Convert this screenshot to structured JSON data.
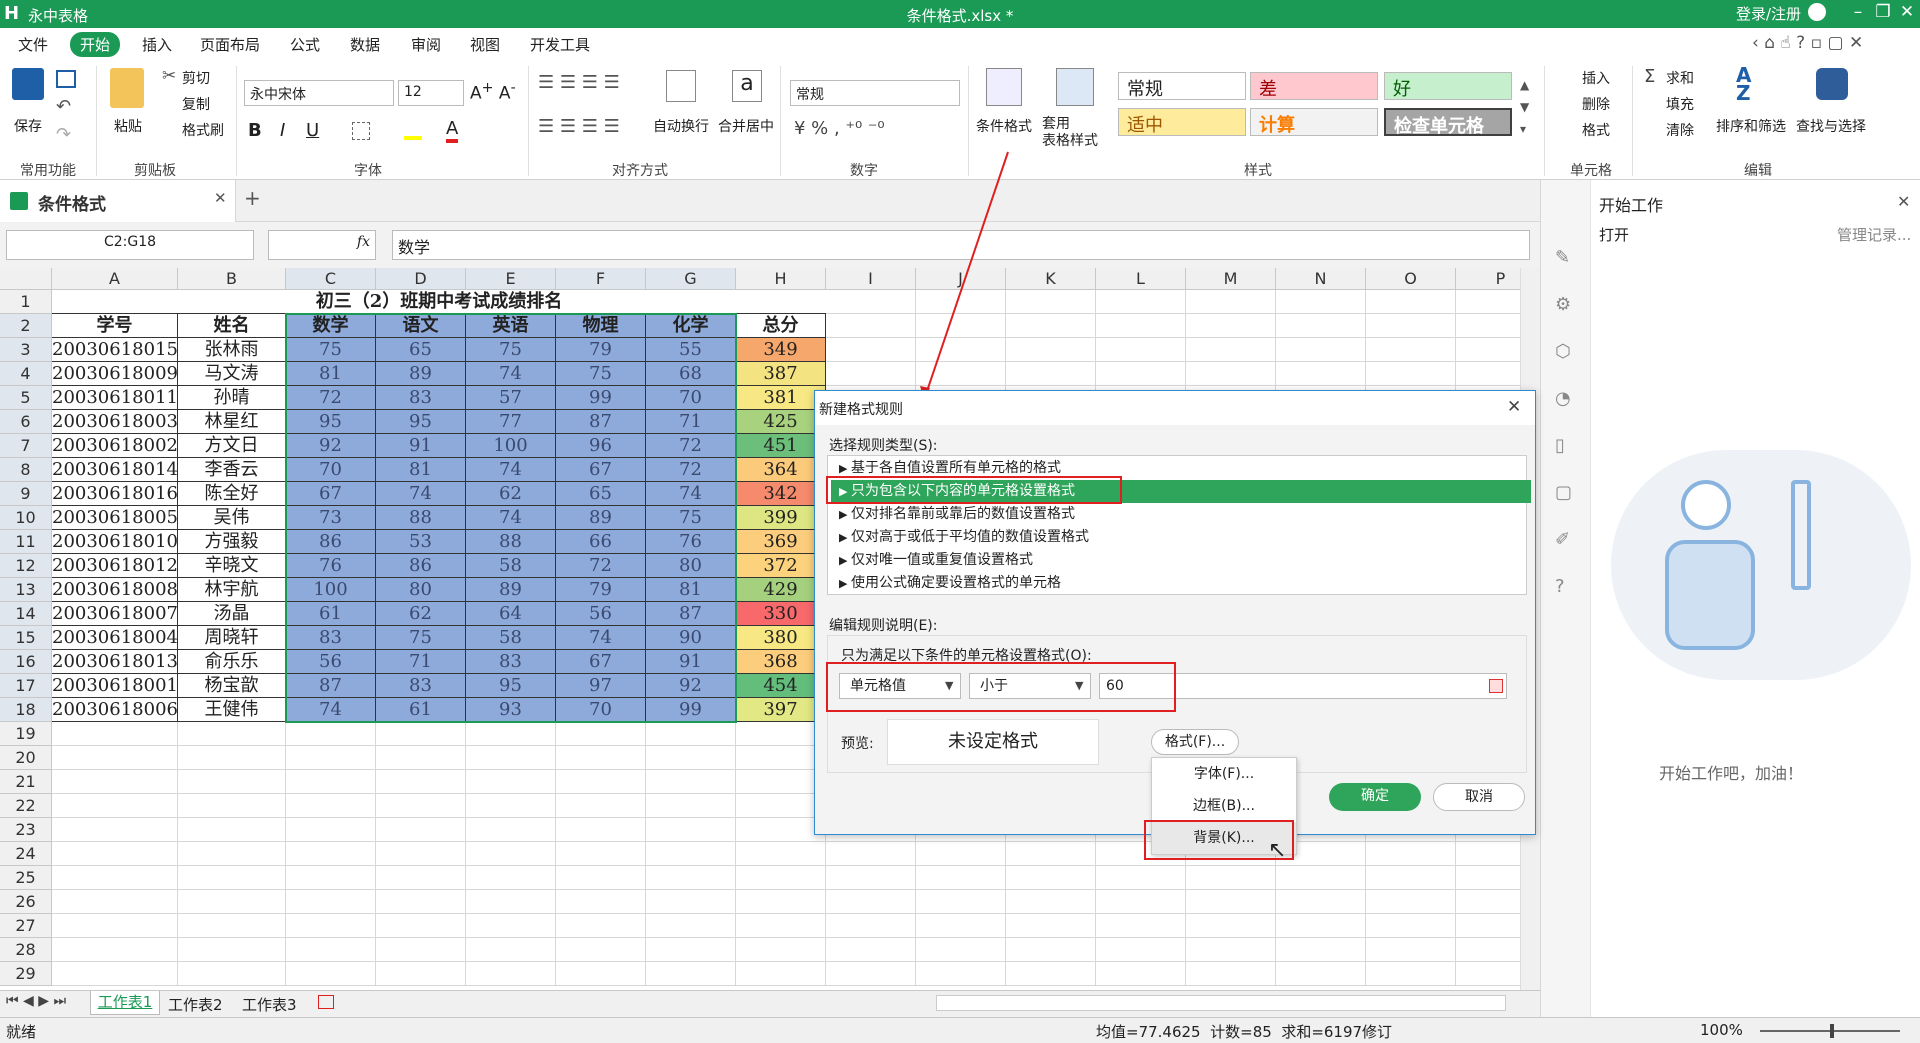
{
  "app": {
    "name": "永中表格",
    "logo": "H",
    "doc_title": "条件格式.xlsx *",
    "login": "登录/注册"
  },
  "menu": [
    "文件",
    "开始",
    "插入",
    "页面布局",
    "公式",
    "数据",
    "审阅",
    "视图",
    "开发工具"
  ],
  "menu_active": "开始",
  "ribbon": {
    "save": "保存",
    "paste": "粘贴",
    "cut": "剪切",
    "copy": "复制",
    "format_painter": "格式刷",
    "font_name": "永中宋体",
    "font_size": "12",
    "wrap": "自动换行",
    "merge": "合并居中",
    "number_format": "常规",
    "cond_format": "条件格式",
    "table_format": "套用\n表格样式",
    "styles": {
      "normal": "常规",
      "bad": "差",
      "good": "好",
      "neutral": "适中",
      "calc": "计算",
      "check": "检查单元格"
    },
    "insert": "插入",
    "delete": "删除",
    "format": "格式",
    "sum": "求和",
    "fill": "填充",
    "clear": "清除",
    "sort": "排序和筛选",
    "find": "查找与选择",
    "groups": {
      "common": "常用功能",
      "clipboard": "剪贴板",
      "font": "字体",
      "align": "对齐方式",
      "number": "数字",
      "style": "样式",
      "cells": "单元格",
      "edit": "编辑"
    }
  },
  "doc_tab": "条件格式",
  "formula_bar": {
    "name_box": "C2:G18",
    "fx": "fx",
    "content": "数学"
  },
  "grid": {
    "columns": [
      "A",
      "B",
      "C",
      "D",
      "E",
      "F",
      "G",
      "H",
      "I",
      "J",
      "K",
      "L",
      "M",
      "N",
      "O",
      "P"
    ],
    "rows": [
      "1",
      "2",
      "3",
      "4",
      "5",
      "6",
      "7",
      "8",
      "9",
      "10",
      "11",
      "12",
      "13",
      "14",
      "15",
      "16",
      "17",
      "18",
      "19",
      "20",
      "21",
      "22",
      "23",
      "24",
      "25",
      "26",
      "27",
      "28",
      "29"
    ],
    "title": "初三（2）班期中考试成绩排名",
    "headers": [
      "学号",
      "姓名",
      "数学",
      "语文",
      "英语",
      "物理",
      "化学",
      "总分"
    ],
    "data": [
      [
        "20030618015",
        "张林雨",
        "75",
        "65",
        "75",
        "79",
        "55",
        "349"
      ],
      [
        "20030618009",
        "马文涛",
        "81",
        "89",
        "74",
        "75",
        "68",
        "387"
      ],
      [
        "20030618011",
        "孙晴",
        "72",
        "83",
        "57",
        "99",
        "70",
        "381"
      ],
      [
        "20030618003",
        "林星红",
        "95",
        "95",
        "77",
        "87",
        "71",
        "425"
      ],
      [
        "20030618002",
        "方文日",
        "92",
        "91",
        "100",
        "96",
        "72",
        "451"
      ],
      [
        "20030618014",
        "李香云",
        "70",
        "81",
        "74",
        "67",
        "72",
        "364"
      ],
      [
        "20030618016",
        "陈全好",
        "67",
        "74",
        "62",
        "65",
        "74",
        "342"
      ],
      [
        "20030618005",
        "吴伟",
        "73",
        "88",
        "74",
        "89",
        "75",
        "399"
      ],
      [
        "20030618010",
        "方强毅",
        "86",
        "53",
        "88",
        "66",
        "76",
        "369"
      ],
      [
        "20030618012",
        "辛晓文",
        "76",
        "86",
        "58",
        "72",
        "80",
        "372"
      ],
      [
        "20030618008",
        "林宇航",
        "100",
        "80",
        "89",
        "79",
        "81",
        "429"
      ],
      [
        "20030618007",
        "汤晶",
        "61",
        "62",
        "64",
        "56",
        "87",
        "330"
      ],
      [
        "20030618004",
        "周晓轩",
        "83",
        "75",
        "58",
        "74",
        "90",
        "380"
      ],
      [
        "20030618013",
        "俞乐乐",
        "56",
        "71",
        "83",
        "67",
        "91",
        "368"
      ],
      [
        "20030618001",
        "杨宝歆",
        "87",
        "83",
        "95",
        "97",
        "92",
        "454"
      ],
      [
        "20030618006",
        "王健伟",
        "74",
        "61",
        "93",
        "70",
        "99",
        "397"
      ]
    ],
    "total_colors": [
      "#f5a76c",
      "#f4e381",
      "#f7e883",
      "#a9d27f",
      "#6cbf7a",
      "#fbcb7b",
      "#f58a6c",
      "#dde682",
      "#fccd7c",
      "#fcd27d",
      "#a5d17e",
      "#f8696b",
      "#f8e884",
      "#fccd7c",
      "#63be7b",
      "#e2e883"
    ]
  },
  "sheets": [
    "工作表1",
    "工作表2",
    "工作表3"
  ],
  "status": {
    "ready": "就绪",
    "stats": "均值=77.4625  计数=85  求和=6197",
    "mode": "修订",
    "zoom": "100%"
  },
  "panel": {
    "title": "开始工作",
    "open": "打开",
    "manage": "管理记录...",
    "slogan": "开始工作吧，加油！"
  },
  "dialog": {
    "title": "新建格式规则",
    "select_type": "选择规则类型(S):",
    "rules": [
      "基于各自值设置所有单元格的格式",
      "只为包含以下内容的单元格设置格式",
      "仅对排名靠前或靠后的数值设置格式",
      "仅对高于或低于平均值的数值设置格式",
      "仅对唯一值或重复值设置格式",
      "使用公式确定要设置格式的单元格"
    ],
    "edit_desc": "编辑规则说明(E):",
    "cond_label": "只为满足以下条件的单元格设置格式(O):",
    "cond_type": "单元格值",
    "cond_op": "小于",
    "cond_value": "60",
    "preview_label": "预览:",
    "preview_text": "未设定格式",
    "format_btn": "格式(F)...",
    "menu": [
      "字体(F)...",
      "边框(B)...",
      "背景(K)..."
    ],
    "ok": "确定",
    "cancel": "取消"
  },
  "colors": {
    "brand": "#1b9a55",
    "selection": "#8eaadb",
    "rule_sel": "#2fa55b",
    "annot": "#e02020"
  }
}
